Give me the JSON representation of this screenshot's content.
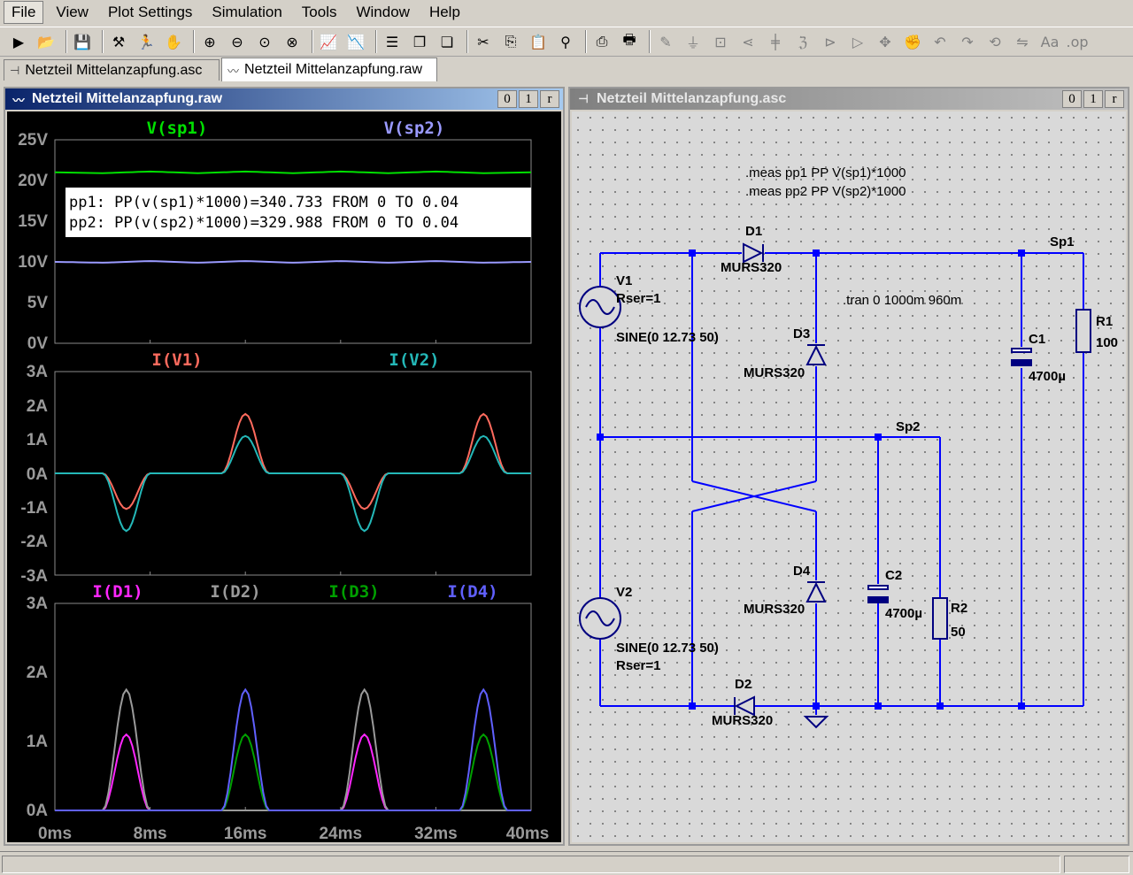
{
  "menu": [
    "File",
    "View",
    "Plot Settings",
    "Simulation",
    "Tools",
    "Window",
    "Help"
  ],
  "toolbar_icons": [
    "run-icon",
    "open-icon",
    "save-icon",
    "control-panel-icon",
    "run-stop-icon",
    "halt-icon",
    "zoom-in-icon",
    "zoom-out-icon",
    "zoom-fit-icon",
    "zoom-cancel-icon",
    "autorange-icon",
    "pick-traces-icon",
    "tile-horizontal-icon",
    "tile-vertical-icon",
    "cascade-icon",
    "cut-icon",
    "copy-icon",
    "paste-icon",
    "find-icon",
    "print-icon",
    "print-setup-icon",
    "wire-icon",
    "ground-icon",
    "label-icon",
    "resistor-icon",
    "capacitor-icon",
    "inductor-icon",
    "diode-icon",
    "component-icon",
    "move-icon",
    "drag-icon",
    "undo-icon",
    "redo-icon",
    "rotate-icon",
    "mirror-icon",
    "text-icon",
    "spice-directive-icon"
  ],
  "tabs": [
    {
      "label": "Netzteil Mittelanzapfung.asc",
      "icon": "schematic-icon"
    },
    {
      "label": "Netzteil Mittelanzapfung.raw",
      "icon": "waveform-icon"
    }
  ],
  "plot_window": {
    "title": "Netzteil Mittelanzapfung.raw",
    "buttons": [
      "0",
      "1",
      "r"
    ],
    "meas_lines": [
      "pp1: PP(v(sp1)*1000)=340.733 FROM 0 TO 0.04",
      "pp2: PP(v(sp2)*1000)=329.988 FROM 0 TO 0.04"
    ],
    "x_ticks": [
      "0ms",
      "8ms",
      "16ms",
      "24ms",
      "32ms",
      "40ms"
    ],
    "panes": [
      {
        "y_ticks": [
          "25V",
          "20V",
          "15V",
          "10V",
          "5V",
          "0V"
        ],
        "traces": [
          {
            "name": "V(sp1)",
            "color": "#00e000"
          },
          {
            "name": "V(sp2)",
            "color": "#9a9aff"
          }
        ]
      },
      {
        "y_ticks": [
          "3A",
          "2A",
          "1A",
          "0A",
          "-1A",
          "-2A",
          "-3A"
        ],
        "traces": [
          {
            "name": "I(V1)",
            "color": "#ff6b5e"
          },
          {
            "name": "I(V2)",
            "color": "#24b8b8"
          }
        ]
      },
      {
        "y_ticks": [
          "3A",
          "2A",
          "1A",
          "0A"
        ],
        "traces": [
          {
            "name": "I(D1)",
            "color": "#ff26ff"
          },
          {
            "name": "I(D2)",
            "color": "#9a9a9a"
          },
          {
            "name": "I(D3)",
            "color": "#00a000"
          },
          {
            "name": "I(D4)",
            "color": "#6060ff"
          }
        ]
      }
    ]
  },
  "chart_data": [
    {
      "type": "line",
      "x": [
        0,
        4,
        8,
        12,
        16,
        20,
        24,
        28,
        32,
        36,
        40
      ],
      "xlabel": "",
      "ylim": [
        0,
        25
      ],
      "series": [
        {
          "name": "V(sp1)",
          "values": [
            21.0,
            20.9,
            21.1,
            20.9,
            21.1,
            20.9,
            21.1,
            20.9,
            21.1,
            20.9,
            21.0
          ]
        },
        {
          "name": "V(sp2)",
          "values": [
            10.0,
            9.9,
            10.1,
            9.9,
            10.1,
            9.9,
            10.1,
            9.9,
            10.1,
            9.9,
            10.0
          ]
        }
      ]
    },
    {
      "type": "line",
      "x": [
        0,
        2,
        4,
        6,
        8,
        10,
        12,
        14,
        16,
        18,
        20,
        22,
        24,
        26,
        28,
        30,
        32,
        34,
        36,
        38,
        40
      ],
      "ylim": [
        -3,
        3
      ],
      "series": [
        {
          "name": "I(V1)",
          "values": [
            0,
            0,
            0,
            -1.05,
            0,
            0,
            0,
            0,
            1.75,
            0,
            0,
            0,
            0,
            -1.05,
            0,
            0,
            0,
            0,
            1.75,
            0,
            0
          ]
        },
        {
          "name": "I(V2)",
          "values": [
            0,
            0,
            0,
            -1.7,
            0,
            0,
            0,
            0,
            1.1,
            0,
            0,
            0,
            0,
            -1.7,
            0,
            0,
            0,
            0,
            1.1,
            0,
            0
          ]
        }
      ]
    },
    {
      "type": "line",
      "x": [
        0,
        2,
        4,
        6,
        8,
        10,
        12,
        14,
        16,
        18,
        20,
        22,
        24,
        26,
        28,
        30,
        32,
        34,
        36,
        38,
        40
      ],
      "ylim": [
        0,
        3
      ],
      "series": [
        {
          "name": "I(D1)",
          "values": [
            0,
            0,
            0,
            1.1,
            0,
            0,
            0,
            0,
            0,
            0,
            0,
            0,
            0,
            1.1,
            0,
            0,
            0,
            0,
            0,
            0,
            0
          ]
        },
        {
          "name": "I(D2)",
          "values": [
            0,
            0,
            0,
            1.75,
            0,
            0,
            0,
            0,
            0,
            0,
            0,
            0,
            0,
            1.75,
            0,
            0,
            0,
            0,
            0,
            0,
            0
          ]
        },
        {
          "name": "I(D3)",
          "values": [
            0,
            0,
            0,
            0,
            0,
            0,
            0,
            0,
            1.1,
            0,
            0,
            0,
            0,
            0,
            0,
            0,
            0,
            0,
            1.1,
            0,
            0
          ]
        },
        {
          "name": "I(D4)",
          "values": [
            0,
            0,
            0,
            0,
            0,
            0,
            0,
            0,
            1.75,
            0,
            0,
            0,
            0,
            0,
            0,
            0,
            0,
            0,
            1.75,
            0,
            0
          ]
        }
      ]
    }
  ],
  "schematic_window": {
    "title": "Netzteil Mittelanzapfung.asc",
    "buttons": [
      "0",
      "1",
      "r"
    ],
    "directives": {
      "meas1": ".meas pp1 PP V(sp1)*1000",
      "meas2": ".meas pp2 PP V(sp2)*1000",
      "tran": ".tran 0 1000m 960m"
    },
    "nets": {
      "sp1": "Sp1",
      "sp2": "Sp2"
    },
    "components": {
      "d1": {
        "name": "D1",
        "value": "MURS320"
      },
      "d2": {
        "name": "D2",
        "value": "MURS320"
      },
      "d3": {
        "name": "D3",
        "value": "MURS320"
      },
      "d4": {
        "name": "D4",
        "value": "MURS320"
      },
      "v1": {
        "name": "V1",
        "value": "SINE(0 12.73 50)",
        "extra": "Rser=1"
      },
      "v2": {
        "name": "V2",
        "value": "SINE(0 12.73 50)",
        "extra": "Rser=1"
      },
      "c1": {
        "name": "C1",
        "value": "4700µ"
      },
      "c2": {
        "name": "C2",
        "value": "4700µ"
      },
      "r1": {
        "name": "R1",
        "value": "100"
      },
      "r2": {
        "name": "R2",
        "value": "50"
      }
    },
    "wire_color": "#0000ff",
    "component_color": "#000080"
  }
}
